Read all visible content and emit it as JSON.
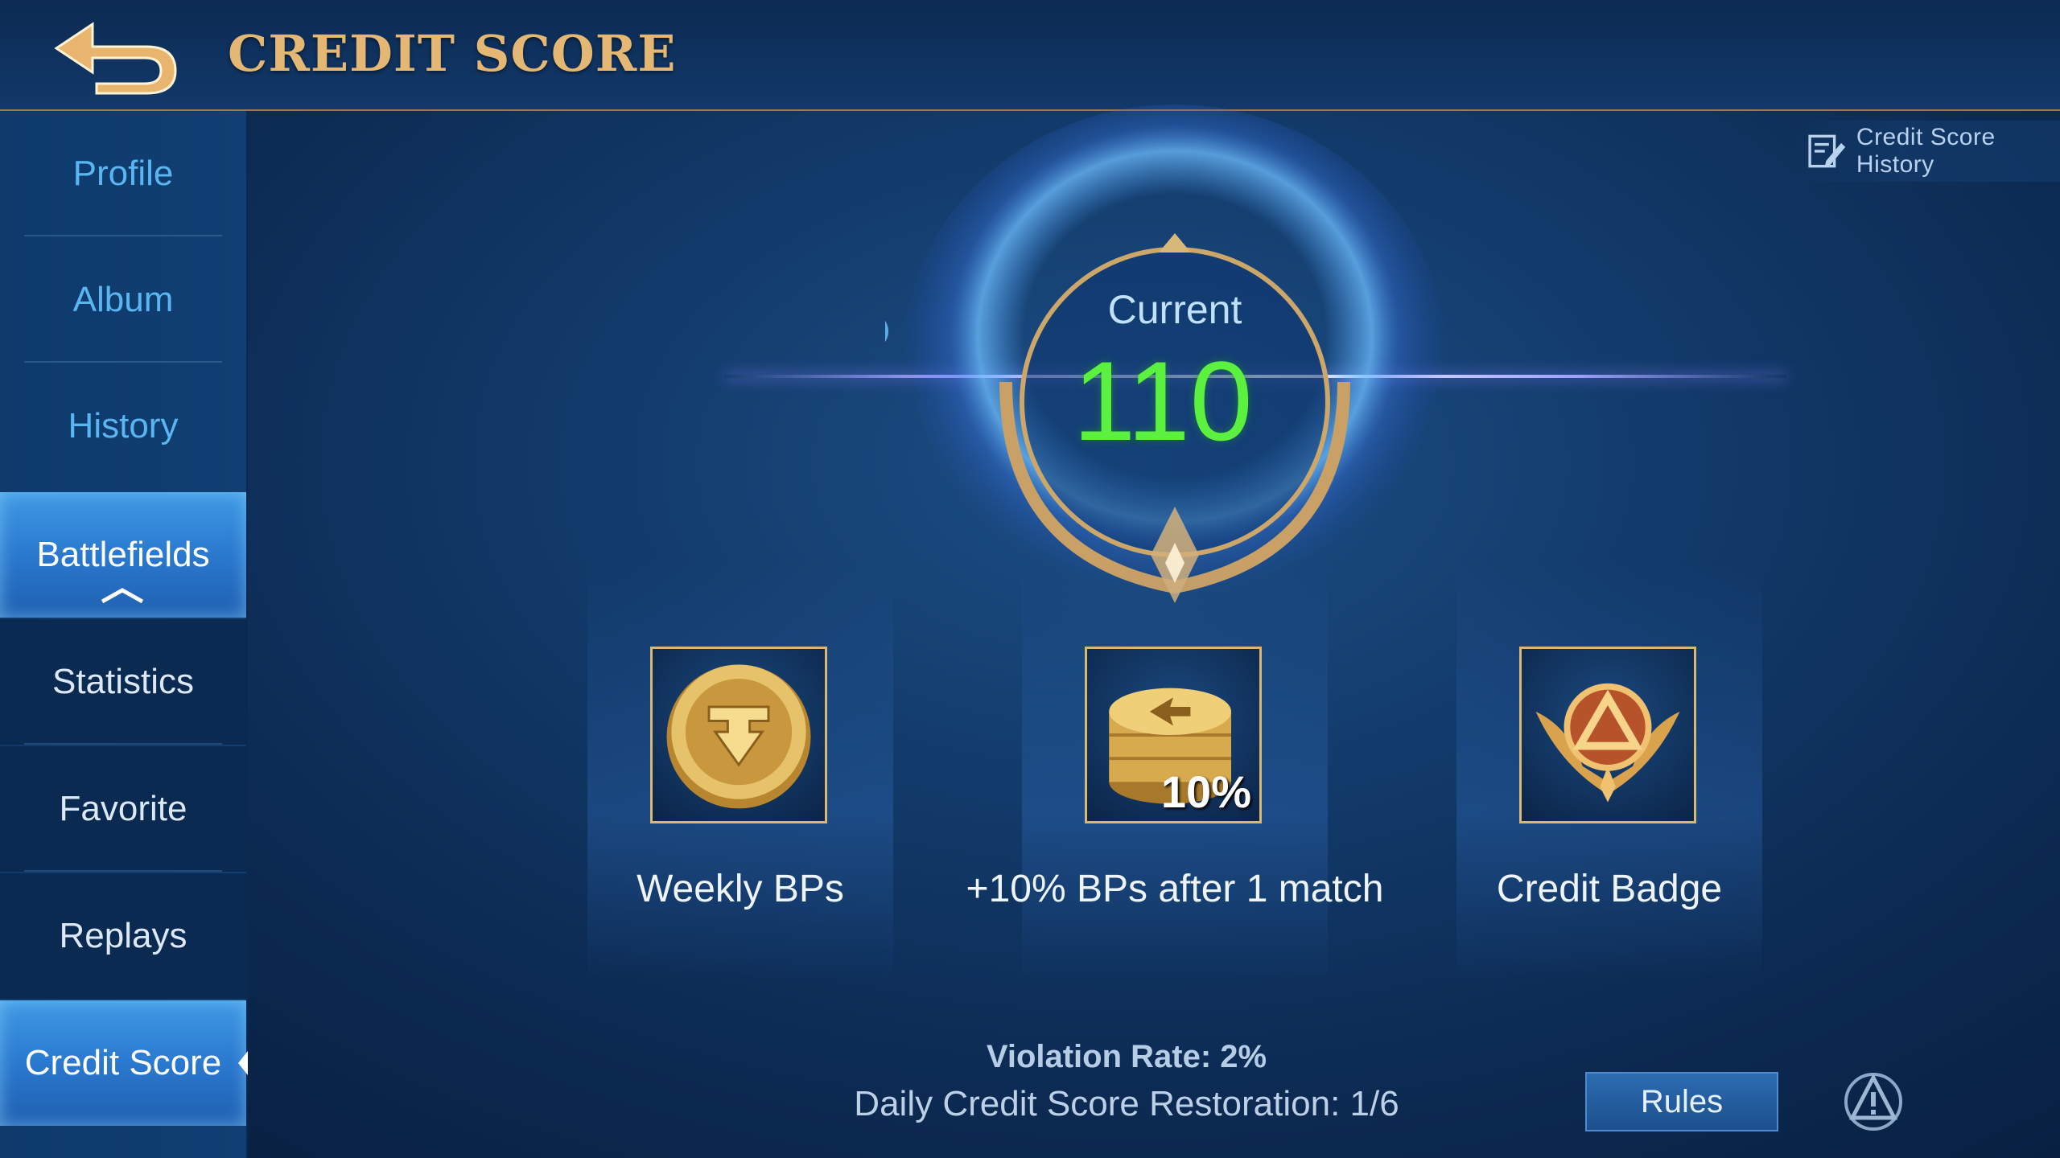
{
  "header": {
    "title": "CREDIT SCORE",
    "back_icon": "back-arrow-icon"
  },
  "sidebar": {
    "items": [
      {
        "label": "Profile"
      },
      {
        "label": "Album"
      },
      {
        "label": "History"
      },
      {
        "label": "Battlefields"
      },
      {
        "label": "Statistics"
      },
      {
        "label": "Favorite"
      },
      {
        "label": "Replays"
      },
      {
        "label": "Credit Score"
      }
    ]
  },
  "history_link": {
    "label": "Credit Score History",
    "icon": "edit-note-icon"
  },
  "score": {
    "label": "Current",
    "value": "110",
    "value_color": "#5cf13e"
  },
  "rewards": [
    {
      "label": "Weekly BPs",
      "icon": "bp-coin-icon"
    },
    {
      "label": "+10% BPs after 1 match",
      "icon": "coin-stack-icon",
      "badge": "10%"
    },
    {
      "label": "Credit Badge",
      "icon": "credit-badge-icon"
    }
  ],
  "footer": {
    "violation_rate": "Violation Rate: 2%",
    "restoration": "Daily Credit Score Restoration: 1/6",
    "rules_label": "Rules",
    "report_icon": "report-warning-icon"
  },
  "colors": {
    "accent_gold": "#e4b874",
    "score_green": "#5cf13e",
    "active_tab": "#2a79cf"
  }
}
